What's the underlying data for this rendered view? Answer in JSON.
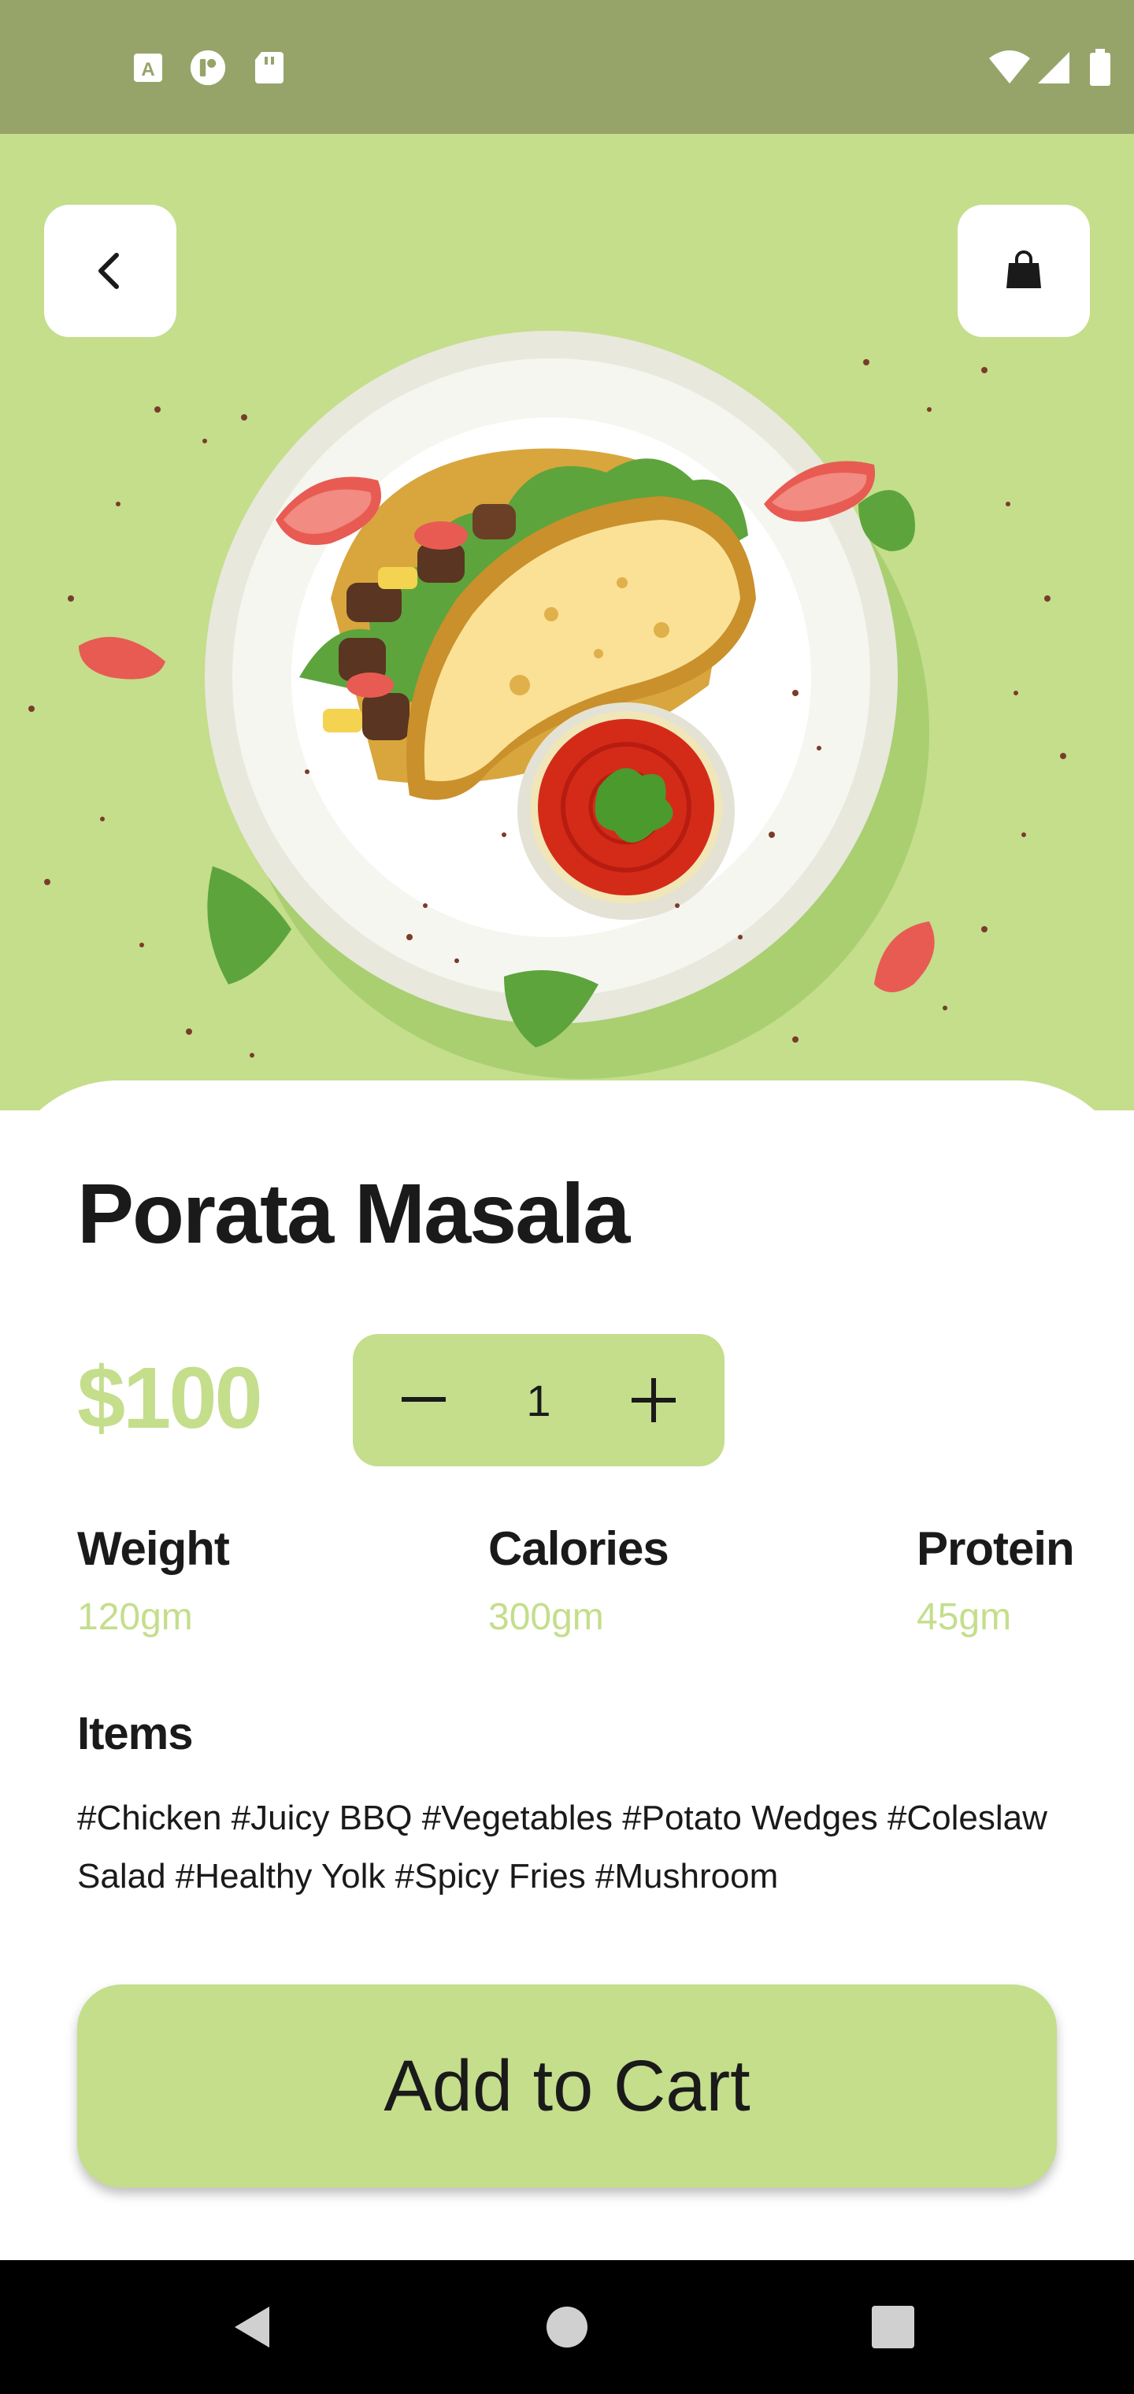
{
  "status_bar": {
    "left_icons": [
      "a-box-icon",
      "media-icon",
      "sd-card-icon"
    ],
    "right_icons": [
      "wifi-icon",
      "signal-icon",
      "battery-icon"
    ]
  },
  "header": {
    "back_icon": "chevron-left-icon",
    "bag_icon": "shopping-bag-icon"
  },
  "product": {
    "name": "Porata Masala",
    "price": "$100",
    "quantity": "1",
    "minus_symbol": "−",
    "plus_symbol": "+"
  },
  "stats": [
    {
      "label": "Weight",
      "value": "120gm"
    },
    {
      "label": "Calories",
      "value": "300gm"
    },
    {
      "label": "Protein",
      "value": "45gm"
    }
  ],
  "items": {
    "heading": "Items",
    "tags": "#Chicken #Juicy BBQ #Vegetables #Potato Wedges #Coleslaw Salad #Healthy Yolk #Spicy Fries #Mushroom"
  },
  "cta": {
    "label": "Add to Cart"
  },
  "colors": {
    "accent": "#c4de8c",
    "status_bar": "#96a46a",
    "text": "#1a1a1a"
  }
}
